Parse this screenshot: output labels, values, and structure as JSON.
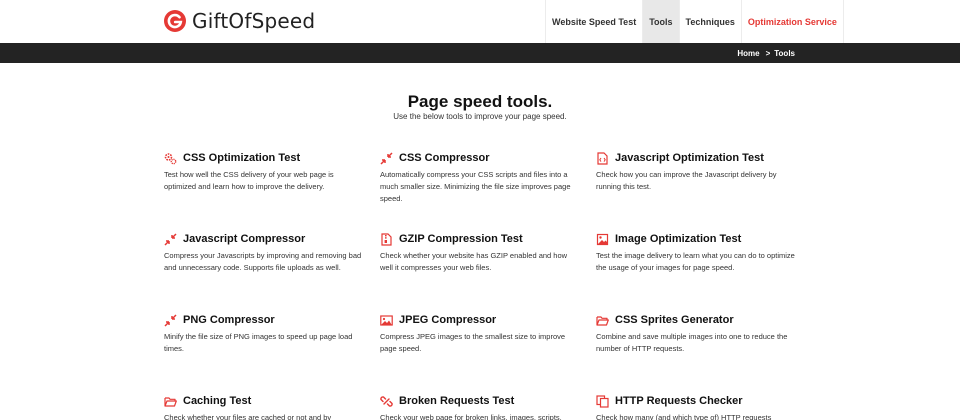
{
  "brand": {
    "name": "GiftOfSpeed",
    "accent": "#e53935"
  },
  "nav": {
    "items": [
      {
        "label": "Website Speed Test",
        "active": false
      },
      {
        "label": "Tools",
        "active": true
      },
      {
        "label": "Techniques",
        "active": false
      },
      {
        "label": "Optimization Service",
        "active": false,
        "highlight": true
      }
    ]
  },
  "breadcrumb": {
    "home": "Home",
    "separator": ">",
    "current": "Tools"
  },
  "page": {
    "title": "Page speed tools.",
    "subtitle": "Use the below tools to improve your page speed."
  },
  "tools": [
    {
      "icon": "gears-icon",
      "title": "CSS Optimization Test",
      "desc": "Test how well the CSS delivery of your web page is optimized and learn how to improve the delivery."
    },
    {
      "icon": "compress-icon",
      "title": "CSS Compressor",
      "desc": "Automatically compress your CSS scripts and files into a much smaller size. Minimizing the file size improves page speed."
    },
    {
      "icon": "code-file-icon",
      "title": "Javascript Optimization Test",
      "desc": "Check how you can improve the Javascript delivery by running this test."
    },
    {
      "icon": "compress-icon",
      "title": "Javascript Compressor",
      "desc": "Compress your Javascripts by improving and removing bad and unnecessary code. Supports file uploads as well."
    },
    {
      "icon": "zip-file-icon",
      "title": "GZIP Compression Test",
      "desc": "Check whether your website has GZIP enabled and how well it compresses your web files."
    },
    {
      "icon": "image-file-icon",
      "title": "Image Optimization Test",
      "desc": "Test the image delivery to learn what you can do to optimize the usage of your images for page speed."
    },
    {
      "icon": "compress-icon",
      "title": "PNG Compressor",
      "desc": "Minify the file size of PNG images to speed up page load times."
    },
    {
      "icon": "picture-icon",
      "title": "JPEG Compressor",
      "desc": "Compress JPEG images to the smallest size to improve page speed."
    },
    {
      "icon": "folder-open-icon",
      "title": "CSS Sprites Generator",
      "desc": "Combine and save multiple images into one to reduce the number of HTTP requests."
    },
    {
      "icon": "folder-open-icon",
      "title": "Caching Test",
      "desc": "Check whether your files are cached or not and by"
    },
    {
      "icon": "broken-link-icon",
      "title": "Broken Requests Test",
      "desc": "Check your web page for broken links, images, scripts,"
    },
    {
      "icon": "copy-files-icon",
      "title": "HTTP Requests Checker",
      "desc": "Check how many (and which type of) HTTP requests"
    }
  ]
}
